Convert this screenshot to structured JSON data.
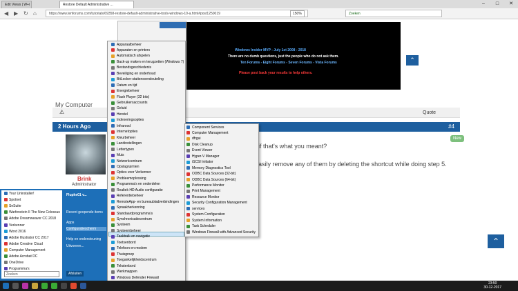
{
  "browser": {
    "tab1": "Edit Views | W+i",
    "tab2": "Restore Default Administrative ...",
    "url": "https://www.tenforums.com/tutorials/69358-restore-default-administrative-tools-windows-10-a.html#post1250019",
    "zoom": "150%",
    "search": "Zoeken"
  },
  "page": {
    "site_title": "Windows Insider MVP - July 1st 2008 - 2018",
    "subtitle": "There are no dumb questions, just the people who do not ask them.",
    "links": "Ten Forums - Eight Forums - Seven Forums - Vista Forums",
    "please": "Please post back your results to help others.",
    "my_computer": "My Computer",
    "quote": "Quote",
    "post_time": "2 Hours Ago",
    "post_num": "#4",
    "new_badge": "New",
    "username": "Brink",
    "role": "Administrator",
    "line1": "if that's what you meant?",
    "line2": "asily remove any of them by deleting the shortcut while doing step 5."
  },
  "start": {
    "left_items": [
      "Your Uninstaller!",
      "Spotnet",
      "SeSuite",
      "Warfenstein II The New Colossus",
      "Adobe Dreamweaver CC 2018",
      "Verkenner",
      "Word 2016",
      "Adobe Illustrator CC 2017",
      "Adobe Creative Cloud",
      "Computer Management",
      "Adobe Acrobat DC",
      "OneDrive",
      "Programma's"
    ],
    "search_placeholder": "Zoeken",
    "user": "Flupke01 v...",
    "right_items": [
      "Recent geopende items",
      "Apps",
      "Configuratiescherm",
      "Help en ondersteuning",
      "Uitvoeren..."
    ],
    "shutdown": "Afsluiten"
  },
  "menu1": [
    "Apparaatbeheer",
    "Apparaten en printers",
    "Automatisch afspelen",
    "Back-up maken en terugzetten (Windows 7)",
    "Bestandsgeschiedenis",
    "Beveiliging en onderhoud",
    "BitLocker-stationsversleuteling",
    "Datum en tijd",
    "Energiebeheer",
    "Flash Player (32 bits)",
    "Gebruikersaccounts",
    "Geluid",
    "Herstel",
    "Indexeringsopties",
    "Infrarood",
    "Internetopties",
    "Kleurbeheer",
    "Landinstellingen",
    "Lettertypen",
    "Muis",
    "Netwerkcentrum",
    "Opslagruimten",
    "Opties voor Verkenner",
    "Probleemoplossing",
    "Programma's en onderdelen",
    "Realtek HD Audio configuratie",
    "Referentiebeheer",
    "RemoteApp- en bureaubladverbindingen",
    "Spraakherkenning",
    "Standaardprogramma's",
    "Synchronisatiecentrum",
    "Systeem",
    "Systeembeheer",
    "Taakbalk en navigatie",
    "Toetsenbord",
    "Telefoon en modem",
    "Thuisgroep",
    "Toegankelijkheidscentrum",
    "Tekstenbord",
    "Werkmappen",
    "Windows Defender Firewall",
    "Windows To Go"
  ],
  "menu2": [
    "Component Services",
    "Computer Management",
    "dfrgui",
    "Disk Cleanup",
    "Event Viewer",
    "Hyper-V Manager",
    "iSCSI Initiator",
    "Memory Diagnostics Tool",
    "ODBC Data Sources (32-bit)",
    "ODBC Data Sources (64-bit)",
    "Performance Monitor",
    "Print Management",
    "Resource Monitor",
    "Security Configuration Management",
    "services",
    "System Configuration",
    "System Information",
    "Task Scheduler",
    "Windows Firewall with Advanced Security"
  ],
  "clock": {
    "time": "23:50",
    "date": "30-12-2017"
  }
}
